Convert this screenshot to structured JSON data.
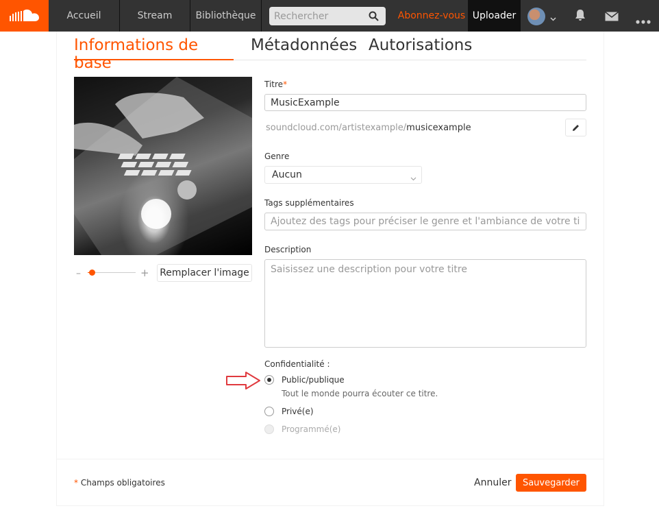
{
  "nav": {
    "logo": "soundcloud-logo",
    "home": "Accueil",
    "stream": "Stream",
    "library": "Bibliothèque",
    "search_placeholder": "Rechercher",
    "subscribe": "Abonnez-vous",
    "upload": "Uploader",
    "accent_color": "#ff5500"
  },
  "tabs": [
    {
      "label": "Informations de base",
      "active": true
    },
    {
      "label": "Métadonnées",
      "active": false
    },
    {
      "label": "Autorisations",
      "active": false
    }
  ],
  "artwork": {
    "replace_label": "Remplacer l'image",
    "zoom_minus": "–",
    "zoom_plus": "+",
    "zoom_level": 0.05
  },
  "form": {
    "title_label": "Titre",
    "required_mark": "*",
    "title_value": "MusicExample",
    "url_prefix": "soundcloud.com/artistexample/",
    "url_slug": "musicexample",
    "genre_label": "Genre",
    "genre_value": "Aucun",
    "tags_label": "Tags supplémentaires",
    "tags_placeholder": "Ajoutez des tags pour préciser le genre et l'ambiance de votre titre",
    "description_label": "Description",
    "description_placeholder": "Saisissez une description pour votre titre",
    "privacy_label": "Confidentialité :",
    "privacy_options": [
      {
        "label": "Public/publique",
        "selected": true,
        "disabled": false,
        "description": "Tout le monde pourra écouter ce titre."
      },
      {
        "label": "Privé(e)",
        "selected": false,
        "disabled": false
      },
      {
        "label": "Programmé(e)",
        "selected": false,
        "disabled": true
      }
    ]
  },
  "footer": {
    "required_note": "Champs obligatoires",
    "cancel": "Annuler",
    "save": "Sauvegarder"
  }
}
